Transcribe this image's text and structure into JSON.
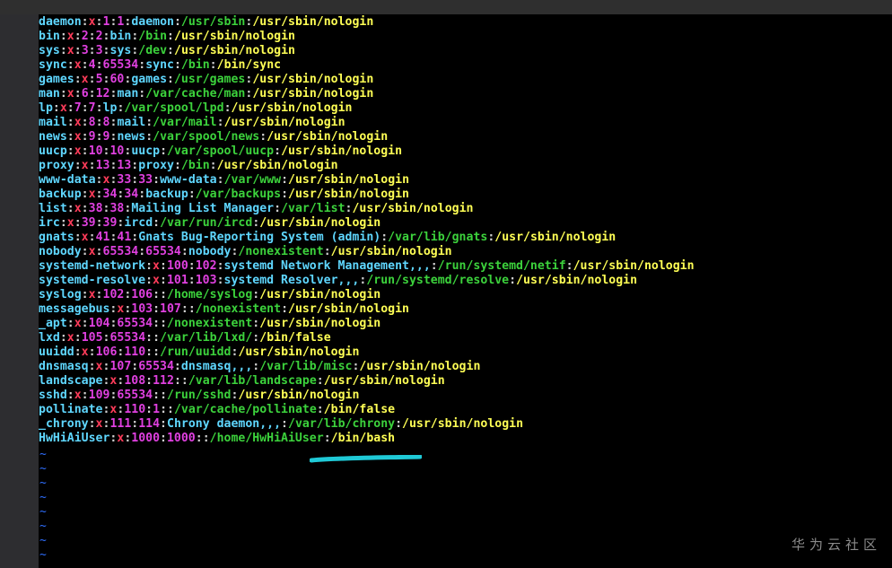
{
  "terminal": {
    "entries": [
      {
        "user": "daemon",
        "password": "x",
        "uid": "1",
        "gid": "1",
        "gecos": "daemon",
        "home": "/usr/sbin",
        "shell": "/usr/sbin/nologin"
      },
      {
        "user": "bin",
        "password": "x",
        "uid": "2",
        "gid": "2",
        "gecos": "bin",
        "home": "/bin",
        "shell": "/usr/sbin/nologin"
      },
      {
        "user": "sys",
        "password": "x",
        "uid": "3",
        "gid": "3",
        "gecos": "sys",
        "home": "/dev",
        "shell": "/usr/sbin/nologin"
      },
      {
        "user": "sync",
        "password": "x",
        "uid": "4",
        "gid": "65534",
        "gecos": "sync",
        "home": "/bin",
        "shell": "/bin/sync"
      },
      {
        "user": "games",
        "password": "x",
        "uid": "5",
        "gid": "60",
        "gecos": "games",
        "home": "/usr/games",
        "shell": "/usr/sbin/nologin"
      },
      {
        "user": "man",
        "password": "x",
        "uid": "6",
        "gid": "12",
        "gecos": "man",
        "home": "/var/cache/man",
        "shell": "/usr/sbin/nologin"
      },
      {
        "user": "lp",
        "password": "x",
        "uid": "7",
        "gid": "7",
        "gecos": "lp",
        "home": "/var/spool/lpd",
        "shell": "/usr/sbin/nologin"
      },
      {
        "user": "mail",
        "password": "x",
        "uid": "8",
        "gid": "8",
        "gecos": "mail",
        "home": "/var/mail",
        "shell": "/usr/sbin/nologin"
      },
      {
        "user": "news",
        "password": "x",
        "uid": "9",
        "gid": "9",
        "gecos": "news",
        "home": "/var/spool/news",
        "shell": "/usr/sbin/nologin"
      },
      {
        "user": "uucp",
        "password": "x",
        "uid": "10",
        "gid": "10",
        "gecos": "uucp",
        "home": "/var/spool/uucp",
        "shell": "/usr/sbin/nologin"
      },
      {
        "user": "proxy",
        "password": "x",
        "uid": "13",
        "gid": "13",
        "gecos": "proxy",
        "home": "/bin",
        "shell": "/usr/sbin/nologin"
      },
      {
        "user": "www-data",
        "password": "x",
        "uid": "33",
        "gid": "33",
        "gecos": "www-data",
        "home": "/var/www",
        "shell": "/usr/sbin/nologin"
      },
      {
        "user": "backup",
        "password": "x",
        "uid": "34",
        "gid": "34",
        "gecos": "backup",
        "home": "/var/backups",
        "shell": "/usr/sbin/nologin"
      },
      {
        "user": "list",
        "password": "x",
        "uid": "38",
        "gid": "38",
        "gecos": "Mailing List Manager",
        "home": "/var/list",
        "shell": "/usr/sbin/nologin"
      },
      {
        "user": "irc",
        "password": "x",
        "uid": "39",
        "gid": "39",
        "gecos": "ircd",
        "home": "/var/run/ircd",
        "shell": "/usr/sbin/nologin"
      },
      {
        "user": "gnats",
        "password": "x",
        "uid": "41",
        "gid": "41",
        "gecos": "Gnats Bug-Reporting System (admin)",
        "home": "/var/lib/gnats",
        "shell": "/usr/sbin/nologin"
      },
      {
        "user": "nobody",
        "password": "x",
        "uid": "65534",
        "gid": "65534",
        "gecos": "nobody",
        "home": "/nonexistent",
        "shell": "/usr/sbin/nologin"
      },
      {
        "user": "systemd-network",
        "password": "x",
        "uid": "100",
        "gid": "102",
        "gecos": "systemd Network Management,,,",
        "home": "/run/systemd/netif",
        "shell": "/usr/sbin/nologin"
      },
      {
        "user": "systemd-resolve",
        "password": "x",
        "uid": "101",
        "gid": "103",
        "gecos": "systemd Resolver,,,",
        "home": "/run/systemd/resolve",
        "shell": "/usr/sbin/nologin"
      },
      {
        "user": "syslog",
        "password": "x",
        "uid": "102",
        "gid": "106",
        "gecos": "",
        "home": "/home/syslog",
        "shell": "/usr/sbin/nologin"
      },
      {
        "user": "messagebus",
        "password": "x",
        "uid": "103",
        "gid": "107",
        "gecos": "",
        "home": "/nonexistent",
        "shell": "/usr/sbin/nologin"
      },
      {
        "user": "_apt",
        "password": "x",
        "uid": "104",
        "gid": "65534",
        "gecos": "",
        "home": "/nonexistent",
        "shell": "/usr/sbin/nologin"
      },
      {
        "user": "lxd",
        "password": "x",
        "uid": "105",
        "gid": "65534",
        "gecos": "",
        "home": "/var/lib/lxd/",
        "shell": "/bin/false"
      },
      {
        "user": "uuidd",
        "password": "x",
        "uid": "106",
        "gid": "110",
        "gecos": "",
        "home": "/run/uuidd",
        "shell": "/usr/sbin/nologin"
      },
      {
        "user": "dnsmasq",
        "password": "x",
        "uid": "107",
        "gid": "65534",
        "gecos": "dnsmasq,,,",
        "home": "/var/lib/misc",
        "shell": "/usr/sbin/nologin"
      },
      {
        "user": "landscape",
        "password": "x",
        "uid": "108",
        "gid": "112",
        "gecos": "",
        "home": "/var/lib/landscape",
        "shell": "/usr/sbin/nologin"
      },
      {
        "user": "sshd",
        "password": "x",
        "uid": "109",
        "gid": "65534",
        "gecos": "",
        "home": "/run/sshd",
        "shell": "/usr/sbin/nologin"
      },
      {
        "user": "pollinate",
        "password": "x",
        "uid": "110",
        "gid": "1",
        "gecos": "",
        "home": "/var/cache/pollinate",
        "shell": "/bin/false"
      },
      {
        "user": "_chrony",
        "password": "x",
        "uid": "111",
        "gid": "114",
        "gecos": "Chrony daemon,,,",
        "home": "/var/lib/chrony",
        "shell": "/usr/sbin/nologin"
      },
      {
        "user": "HwHiAiUser",
        "password": "x",
        "uid": "1000",
        "gid": "1000",
        "gecos": "",
        "home": "/home/HwHiAiUser",
        "shell": "/bin/bash"
      }
    ],
    "separator": ":",
    "empty_line_marker": "~",
    "empty_line_count": 9
  },
  "annotation": {
    "color": "#1fc9d6"
  },
  "watermark": {
    "text": "华为云社区"
  },
  "colors": {
    "user": "#5fd7ff",
    "password": "#ff3c5a",
    "ids": "#e040e0",
    "home": "#3cd23c",
    "shell": "#ffff55",
    "tilde": "#2f6fff"
  }
}
